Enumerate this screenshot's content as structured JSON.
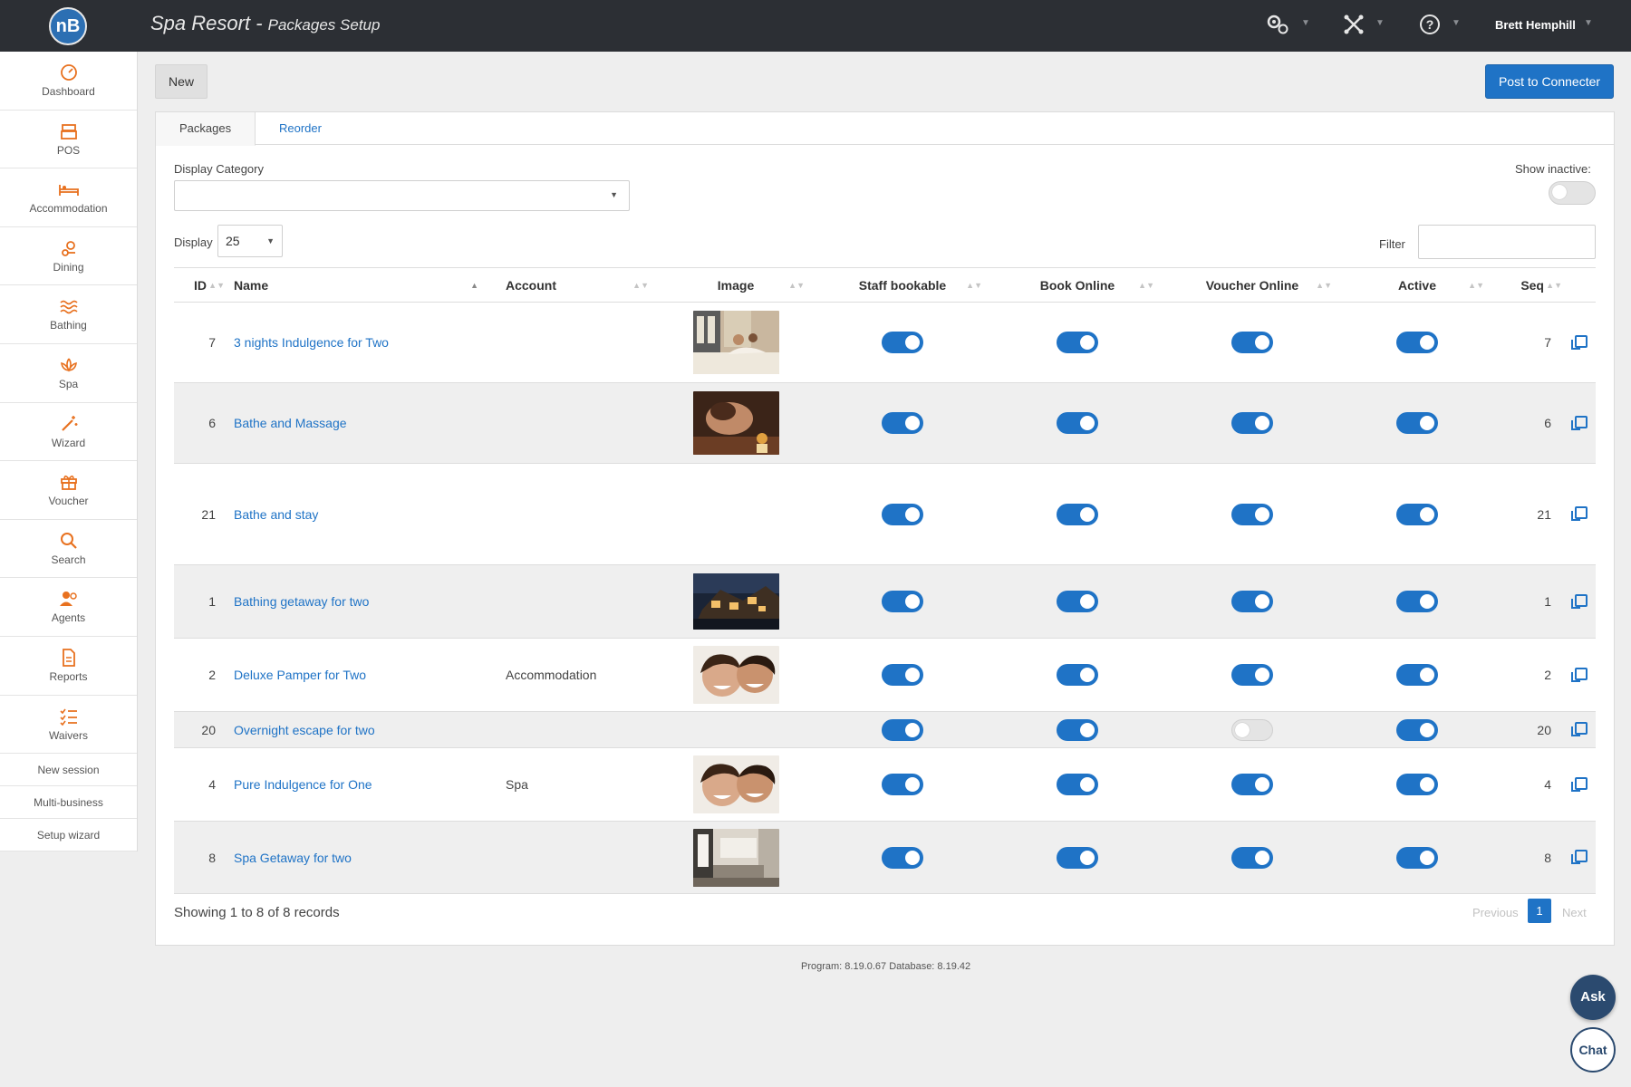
{
  "header": {
    "logo": "nB",
    "title": "Spa Resort",
    "subtitle": "Packages Setup",
    "user": "Brett Hemphill",
    "icons": [
      "settings-gears-icon",
      "connect-icon",
      "help-icon"
    ]
  },
  "sidebar": {
    "items": [
      {
        "label": "Dashboard",
        "icon": "dashboard-icon"
      },
      {
        "label": "POS",
        "icon": "register-icon"
      },
      {
        "label": "Accommodation",
        "icon": "bed-icon"
      },
      {
        "label": "Dining",
        "icon": "dining-icon"
      },
      {
        "label": "Bathing",
        "icon": "waves-icon"
      },
      {
        "label": "Spa",
        "icon": "lotus-icon"
      },
      {
        "label": "Wizard",
        "icon": "magic-wand-icon"
      },
      {
        "label": "Voucher",
        "icon": "gift-icon"
      },
      {
        "label": "Search",
        "icon": "search-icon"
      },
      {
        "label": "Agents",
        "icon": "agents-icon"
      },
      {
        "label": "Reports",
        "icon": "report-icon"
      },
      {
        "label": "Waivers",
        "icon": "checklist-icon"
      }
    ],
    "links": [
      "New session",
      "Multi-business",
      "Setup wizard"
    ]
  },
  "toolbar": {
    "new_label": "New",
    "post_label": "Post to Connecter"
  },
  "tabs": [
    "Packages",
    "Reorder"
  ],
  "filters": {
    "category_label": "Display Category",
    "category_value": "",
    "show_inactive_label": "Show inactive:",
    "show_inactive": false,
    "display_label": "Display",
    "display_value": "25",
    "filter_label": "Filter",
    "filter_value": ""
  },
  "table": {
    "columns": [
      "ID",
      "Name",
      "Account",
      "Image",
      "Staff bookable",
      "Book Online",
      "Voucher Online",
      "Active",
      "Seq"
    ],
    "rows": [
      {
        "id": "7",
        "name": "3 nights Indulgence for Two",
        "account": "",
        "image": "couple-in-bed",
        "staff": true,
        "online": true,
        "voucher": true,
        "active": true,
        "seq": "7"
      },
      {
        "id": "6",
        "name": "Bathe and Massage",
        "account": "",
        "image": "massage",
        "staff": true,
        "online": true,
        "voucher": true,
        "active": true,
        "seq": "6"
      },
      {
        "id": "21",
        "name": "Bathe and stay",
        "account": "",
        "image": "",
        "staff": true,
        "online": true,
        "voucher": true,
        "active": true,
        "seq": "21"
      },
      {
        "id": "1",
        "name": "Bathing getaway for two",
        "account": "",
        "image": "resort-night",
        "staff": true,
        "online": true,
        "voucher": true,
        "active": true,
        "seq": "1"
      },
      {
        "id": "2",
        "name": "Deluxe Pamper for Two",
        "account": "Accommodation",
        "image": "smiling-couple",
        "staff": true,
        "online": true,
        "voucher": true,
        "active": true,
        "seq": "2"
      },
      {
        "id": "20",
        "name": "Overnight escape for two",
        "account": "",
        "image": "",
        "staff": true,
        "online": true,
        "voucher": false,
        "active": true,
        "seq": "20"
      },
      {
        "id": "4",
        "name": "Pure Indulgence for One",
        "account": "Spa",
        "image": "smiling-couple",
        "staff": true,
        "online": true,
        "voucher": true,
        "active": true,
        "seq": "4"
      },
      {
        "id": "8",
        "name": "Spa Getaway for two",
        "account": "",
        "image": "hotel-room",
        "staff": true,
        "online": true,
        "voucher": true,
        "active": true,
        "seq": "8"
      }
    ]
  },
  "footer": {
    "showing": "Showing 1 to 8 of 8 records",
    "previous": "Previous",
    "page": "1",
    "next": "Next",
    "version": "Program: 8.19.0.67 Database: 8.19.42"
  },
  "help": {
    "ask": "Ask",
    "chat": "Chat"
  },
  "colors": {
    "topbar": "#2c2f34",
    "accent": "#1f73c6",
    "sidebar_icon": "#e8711f"
  }
}
